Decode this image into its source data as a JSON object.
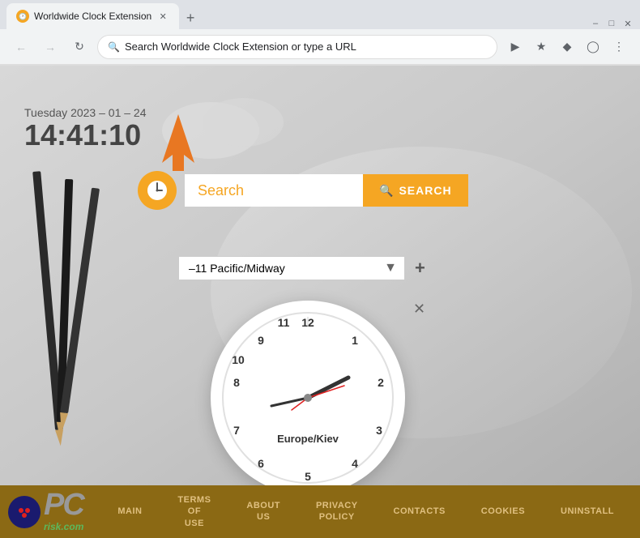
{
  "browser": {
    "tab_title": "Worldwide Clock Extension",
    "address_bar_text": "Search Worldwide Clock Extension or type a URL"
  },
  "page": {
    "date": "Tuesday 2023 – 01 – 24",
    "time": "14:41:10",
    "search_placeholder": "Search",
    "search_button_label": "SEARCH",
    "timezone_value": "–11 Pacific/Midway",
    "clock_label": "Europe/Kiev",
    "clock_hours": [
      12,
      1,
      2,
      3,
      4,
      5,
      6,
      7,
      8,
      9,
      10,
      11
    ]
  },
  "footer": {
    "items": [
      {
        "label": "MAIN"
      },
      {
        "label": "TERMS OF USE"
      },
      {
        "label": "ABOUT US"
      },
      {
        "label": "PRIVACY POLICY"
      },
      {
        "label": "CONTACTS"
      },
      {
        "label": "COOKIES"
      },
      {
        "label": "UNINSTALL"
      }
    ]
  }
}
